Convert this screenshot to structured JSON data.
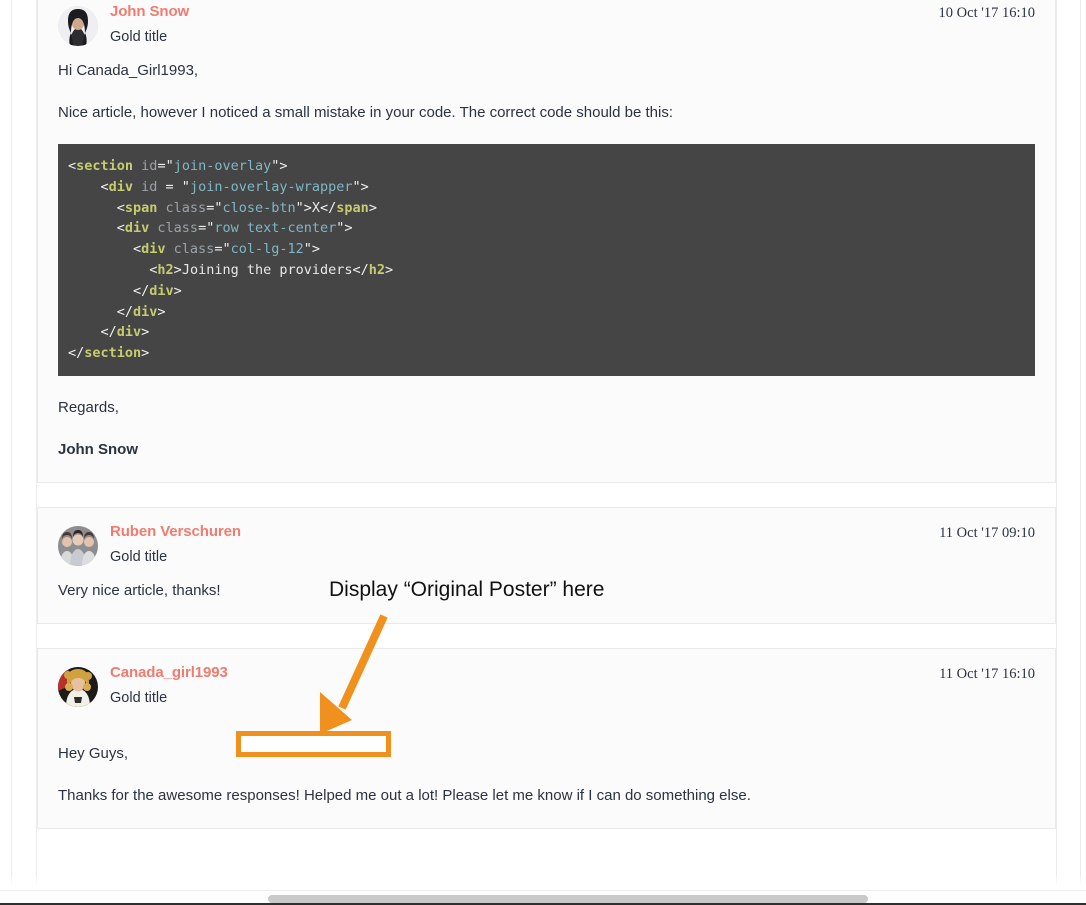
{
  "page": {
    "type": "forum-thread-replies",
    "accent_author_color": "#f07c70",
    "annotation_color": "#f0911e",
    "code_background": "#454545",
    "card_background": "#fbfbfb"
  },
  "posts": [
    {
      "author": "John Snow",
      "user_title": "Gold title",
      "timestamp": "10 Oct '17 16:10",
      "avatar_name": "avatar-john-snow",
      "paragraphs": [
        "Hi Canada_Girl1993,",
        "Nice article, however I noticed a small mistake in your code. The correct code should be this:"
      ],
      "code_lines": [
        [
          {
            "t": "p",
            "s": "<"
          },
          {
            "t": "t",
            "s": "section"
          },
          {
            "t": "a",
            "s": " id"
          },
          {
            "t": "p",
            "s": "=\""
          },
          {
            "t": "v",
            "s": "join-overlay"
          },
          {
            "t": "p",
            "s": "\">"
          }
        ],
        [
          {
            "t": "p",
            "s": "    <"
          },
          {
            "t": "t",
            "s": "div"
          },
          {
            "t": "a",
            "s": " id "
          },
          {
            "t": "p",
            "s": "= \""
          },
          {
            "t": "v",
            "s": "join-overlay-wrapper"
          },
          {
            "t": "p",
            "s": "\">"
          }
        ],
        [
          {
            "t": "p",
            "s": "      <"
          },
          {
            "t": "t",
            "s": "span"
          },
          {
            "t": "a",
            "s": " class"
          },
          {
            "t": "p",
            "s": "=\""
          },
          {
            "t": "v",
            "s": "close-btn"
          },
          {
            "t": "p",
            "s": "\">"
          },
          {
            "t": "x",
            "s": "X"
          },
          {
            "t": "p",
            "s": "</"
          },
          {
            "t": "t",
            "s": "span"
          },
          {
            "t": "p",
            "s": ">"
          }
        ],
        [
          {
            "t": "p",
            "s": "      <"
          },
          {
            "t": "t",
            "s": "div"
          },
          {
            "t": "a",
            "s": " class"
          },
          {
            "t": "p",
            "s": "=\""
          },
          {
            "t": "v",
            "s": "row text-center"
          },
          {
            "t": "p",
            "s": "\">"
          }
        ],
        [
          {
            "t": "p",
            "s": "        <"
          },
          {
            "t": "t",
            "s": "div"
          },
          {
            "t": "a",
            "s": " class"
          },
          {
            "t": "p",
            "s": "=\""
          },
          {
            "t": "v",
            "s": "col-lg-12"
          },
          {
            "t": "p",
            "s": "\">"
          }
        ],
        [
          {
            "t": "p",
            "s": "          <"
          },
          {
            "t": "t",
            "s": "h2"
          },
          {
            "t": "p",
            "s": ">"
          },
          {
            "t": "x",
            "s": "Joining the providers"
          },
          {
            "t": "p",
            "s": "</"
          },
          {
            "t": "t",
            "s": "h2"
          },
          {
            "t": "p",
            "s": ">"
          }
        ],
        [
          {
            "t": "p",
            "s": "        </"
          },
          {
            "t": "t",
            "s": "div"
          },
          {
            "t": "p",
            "s": ">"
          }
        ],
        [
          {
            "t": "p",
            "s": "      </"
          },
          {
            "t": "t",
            "s": "div"
          },
          {
            "t": "p",
            "s": ">"
          }
        ],
        [
          {
            "t": "p",
            "s": "    </"
          },
          {
            "t": "t",
            "s": "div"
          },
          {
            "t": "p",
            "s": ">"
          }
        ],
        [
          {
            "t": "p",
            "s": "</"
          },
          {
            "t": "t",
            "s": "section"
          },
          {
            "t": "p",
            "s": ">"
          }
        ]
      ],
      "closing": "Regards,",
      "signature": "John Snow"
    },
    {
      "author": "Ruben Verschuren",
      "user_title": "Gold title",
      "timestamp": "11 Oct '17 09:10",
      "avatar_name": "avatar-ruben-verschuren",
      "paragraphs": [
        "Very nice article, thanks!"
      ]
    },
    {
      "author": "Canada_girl1993",
      "user_title": "Gold title",
      "timestamp": "11 Oct '17 16:10",
      "avatar_name": "avatar-canada-girl1993",
      "paragraphs": [
        "Hey Guys,",
        "Thanks for the awesome responses! Helped me out a lot! Please let me know if I can do something else."
      ]
    }
  ],
  "annotation": {
    "text": "Display “Original Poster” here",
    "color": "#f0911e",
    "arrow": "down-left-arrow",
    "highlight_box_label": ""
  }
}
